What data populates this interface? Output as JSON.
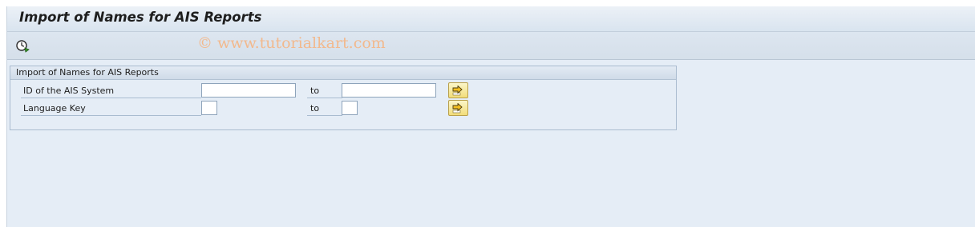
{
  "page": {
    "title": "Import of Names for AIS Reports",
    "watermark": "© www.tutorialkart.com"
  },
  "toolbar": {
    "execute_icon": "execute-clock-icon"
  },
  "selection_group": {
    "title": "Import of Names for AIS Reports",
    "rows": [
      {
        "label": "ID of the AIS System",
        "to_label": "to",
        "from_value": "",
        "to_value": "",
        "button_icon": "multiple-selection-arrow-icon"
      },
      {
        "label": "Language Key",
        "to_label": "to",
        "from_value": "",
        "to_value": "",
        "button_icon": "multiple-selection-arrow-icon"
      }
    ]
  },
  "colors": {
    "background": "#e5edf6",
    "button_yellow": "#f2dd7a",
    "watermark": "#f2b98d"
  }
}
